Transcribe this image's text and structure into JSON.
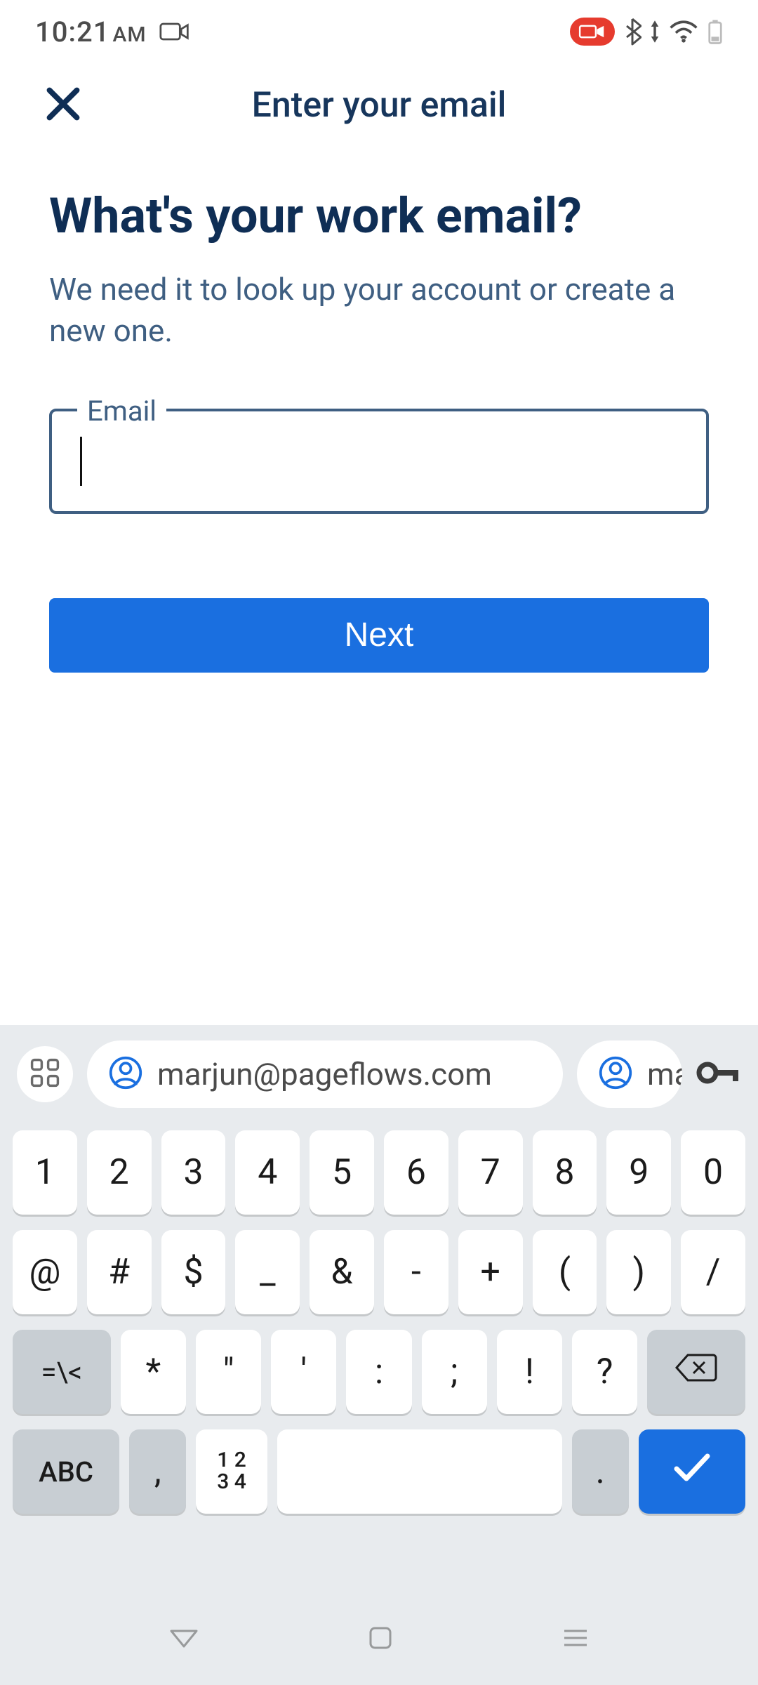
{
  "status": {
    "time": "10:21",
    "ampm": "AM"
  },
  "header": {
    "title": "Enter your email"
  },
  "content": {
    "question": "What's your work email?",
    "subtext": "We need it to look up your account or create a new one.",
    "email_label": "Email",
    "email_value": "",
    "next_label": "Next"
  },
  "keyboard": {
    "suggestion_main": "marjun@pageflows.com",
    "suggestion_partial": "ma",
    "row1": [
      "1",
      "2",
      "3",
      "4",
      "5",
      "6",
      "7",
      "8",
      "9",
      "0"
    ],
    "row2": [
      "@",
      "#",
      "$",
      "_",
      "&",
      "-",
      "+",
      "(",
      ")",
      "/"
    ],
    "row3_shift": "=\\<",
    "row3": [
      "*",
      "\"",
      "'",
      ":",
      ";",
      "!",
      "?"
    ],
    "row4_mode": "ABC",
    "row4_comma": ",",
    "row4_numstack_top": "1 2",
    "row4_numstack_bot": "3 4",
    "row4_period": "."
  }
}
